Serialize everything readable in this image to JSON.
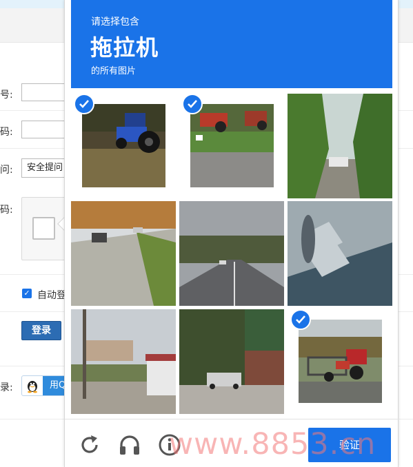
{
  "background": {
    "labels": {
      "account": "号:",
      "password": "码:",
      "question": "问:",
      "captcha": "码:",
      "other": "录:"
    },
    "question_select": "安全提问",
    "auto_login": "自动登",
    "login_button": "登录",
    "qq_button": "用Q"
  },
  "challenge": {
    "header": {
      "line1": "请选择包含",
      "line2": "拖拉机",
      "line3": "的所有图片"
    },
    "tiles": [
      {
        "scene": "blue tractor on grass",
        "selected": true
      },
      {
        "scene": "red tractors by road",
        "selected": true
      },
      {
        "scene": "trees and parked car",
        "selected": false
      },
      {
        "scene": "street with cars",
        "selected": false
      },
      {
        "scene": "highway",
        "selected": false
      },
      {
        "scene": "crosswalk shadow",
        "selected": false
      },
      {
        "scene": "street with buildings",
        "selected": false
      },
      {
        "scene": "parking lot with truck",
        "selected": false
      },
      {
        "scene": "red tractor with trailer",
        "selected": true
      }
    ],
    "tools": {
      "reload": "reload-icon",
      "audio": "headphones-icon",
      "info": "info-icon"
    },
    "verify_button": "验证"
  },
  "watermark": "www.8853.cn",
  "colors": {
    "accent": "#1a73e8"
  }
}
